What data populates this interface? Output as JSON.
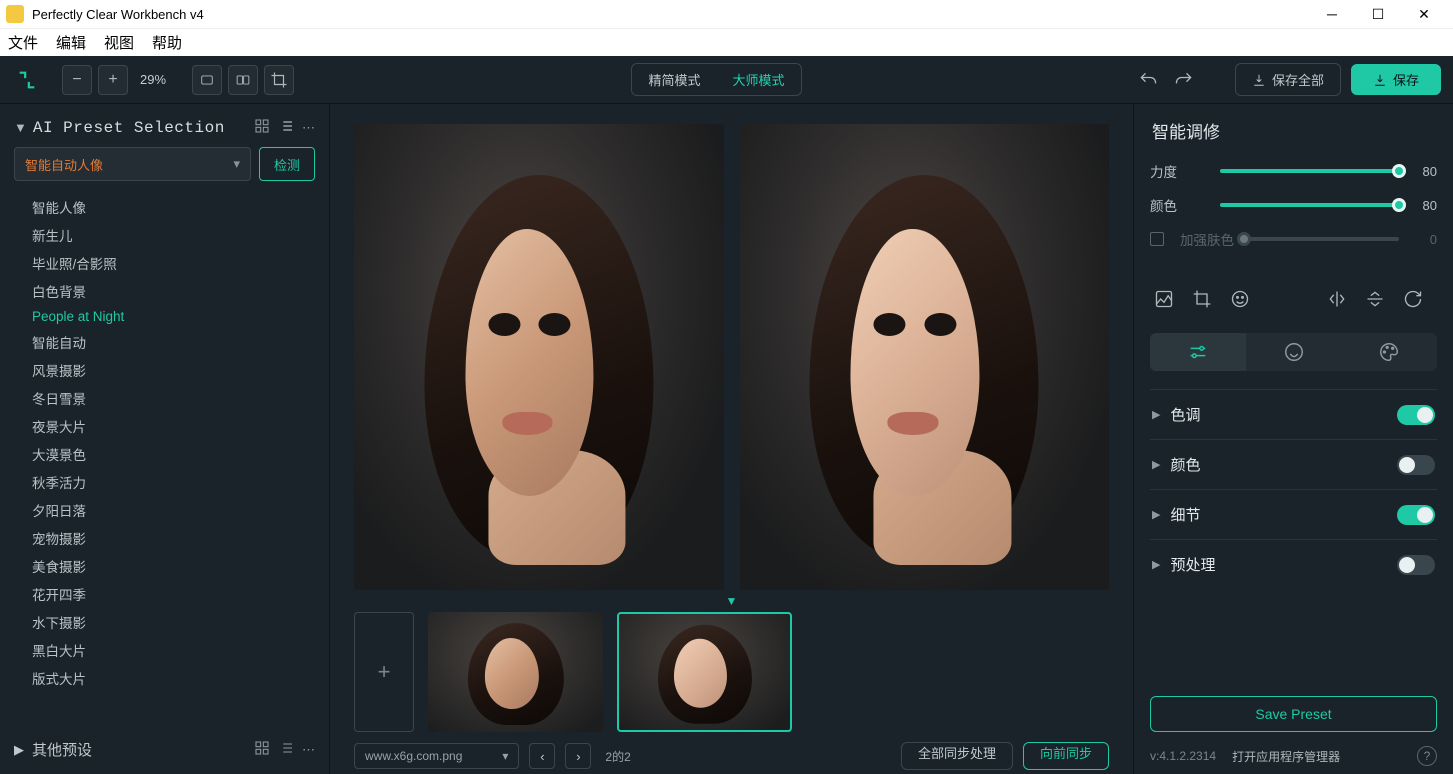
{
  "window": {
    "title": "Perfectly Clear Workbench v4"
  },
  "menu": {
    "file": "文件",
    "edit": "编辑",
    "view": "视图",
    "help": "帮助"
  },
  "toolbar": {
    "zoom": "29%",
    "mode_simple": "精简模式",
    "mode_master": "大师模式",
    "save_all": "保存全部",
    "save": "保存"
  },
  "left": {
    "header": "AI Preset Selection",
    "dropdown": "智能自动人像",
    "detect": "检测",
    "presets": [
      "智能人像",
      "新生儿",
      "毕业照/合影照",
      "白色背景",
      "People at Night",
      "智能自动",
      "风景摄影",
      "冬日雪景",
      "夜景大片",
      "大漠景色",
      "秋季活力",
      "夕阳日落",
      "宠物摄影",
      "美食摄影",
      "花开四季",
      "水下摄影",
      "黑白大片",
      "版式大片"
    ],
    "selected_index": 4,
    "footer": "其他预设"
  },
  "bottom": {
    "filename": "www.x6g.com.png",
    "page": "2的2",
    "sync_all": "全部同步处理",
    "sync_fwd": "向前同步"
  },
  "right": {
    "title": "智能调修",
    "sliders": {
      "strength": {
        "label": "力度",
        "value": 80
      },
      "color": {
        "label": "颜色",
        "value": 80
      },
      "skin": {
        "label": "加强肤色",
        "value": 0
      }
    },
    "sections": {
      "tone": {
        "label": "色调",
        "on": true
      },
      "color": {
        "label": "颜色",
        "on": false
      },
      "detail": {
        "label": "细节",
        "on": true
      },
      "preprocess": {
        "label": "预处理",
        "on": false
      }
    },
    "save_preset": "Save Preset",
    "version": "v:4.1.2.2314",
    "manager": "打开应用程序管理器"
  }
}
